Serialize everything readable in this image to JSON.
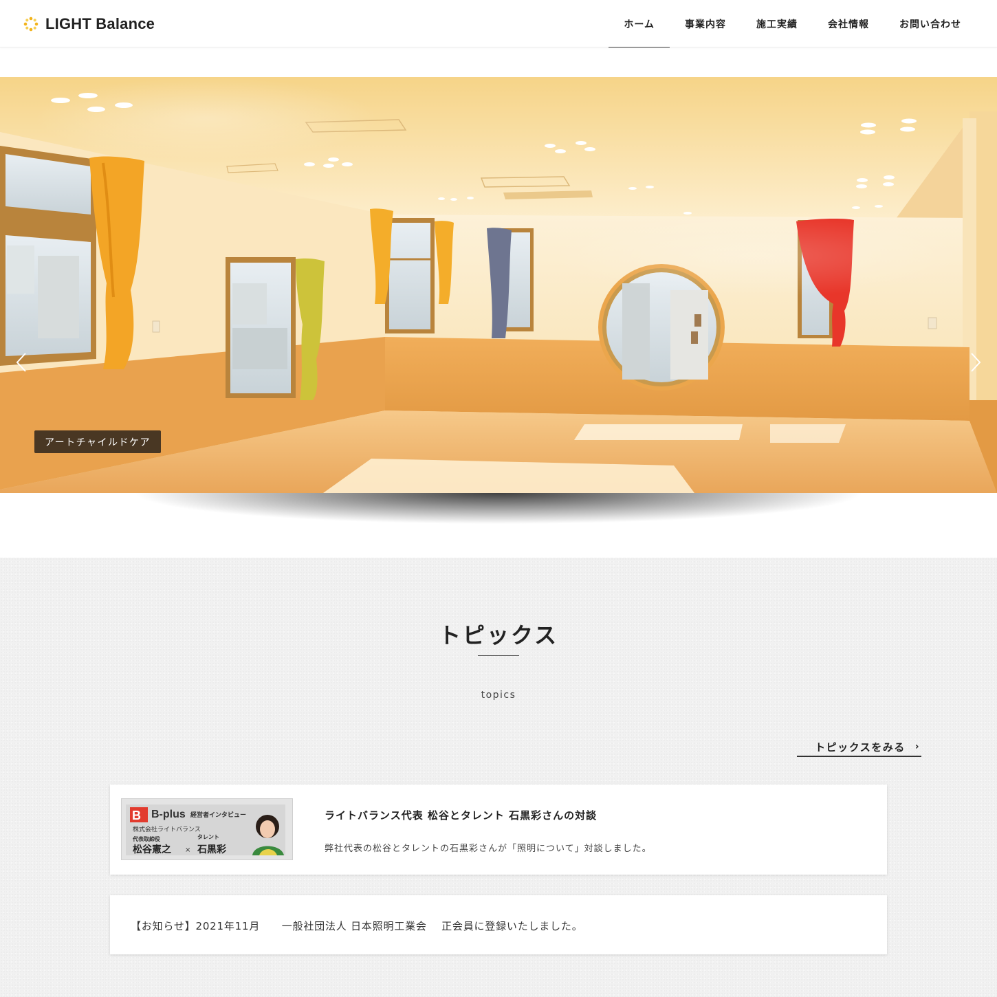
{
  "header": {
    "logo_text": "LIGHT Balance",
    "logo_icon": "sunburst-logo-icon",
    "nav": [
      {
        "label": "ホーム",
        "active": true
      },
      {
        "label": "事業内容",
        "active": false
      },
      {
        "label": "施工実績",
        "active": false
      },
      {
        "label": "会社情報",
        "active": false
      },
      {
        "label": "お問い合わせ",
        "active": false
      }
    ]
  },
  "slider": {
    "caption": "アートチャイルドケア",
    "prev_icon": "chevron-left-icon",
    "next_icon": "chevron-right-icon"
  },
  "topics": {
    "title": "トピックス",
    "subtitle": "topics",
    "more_label": "トピックスをみる",
    "more_icon": "chevron-right-icon",
    "items": [
      {
        "title": "ライトバランス代表 松谷とタレント 石黒彩さんの対談",
        "description": "弊社代表の松谷とタレントの石黒彩さんが「照明について」対談しました。",
        "thumbnail": {
          "brand": "B-plus",
          "heading": "経営者インタビュー",
          "company": "株式会社ライトバランス",
          "role1": "代表取締役",
          "name1": "松谷憲之",
          "times": "×",
          "role2": "タレント",
          "name2": "石黒彩"
        }
      },
      {
        "text": "【お知らせ】2021年11月　　一般社団法人 日本照明工業会　 正会員に登録いたしました。"
      }
    ]
  },
  "colors": {
    "accent": "#222222",
    "section_bg": "#f1f1f1",
    "caption_bg": "#32281e"
  }
}
